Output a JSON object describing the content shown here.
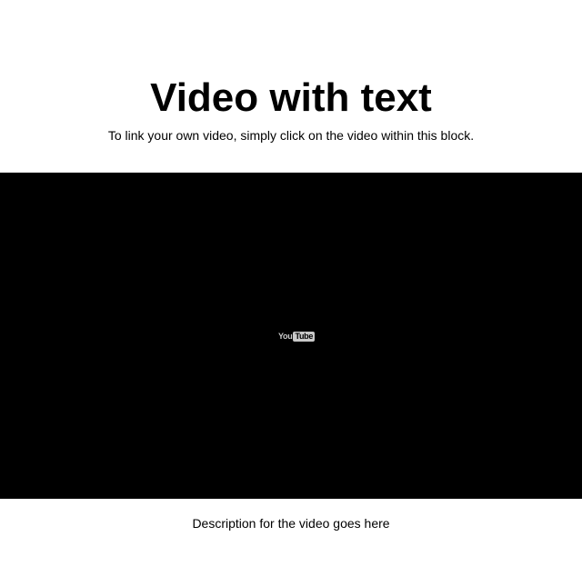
{
  "header": {
    "title": "Video with text",
    "subtitle": "To link your own video, simply click on the video within this block."
  },
  "video": {
    "logo_you": "You",
    "logo_tube": "Tube",
    "icon": "youtube-logo-icon",
    "background_color": "#000000"
  },
  "footer": {
    "description": "Description for the video goes here"
  }
}
